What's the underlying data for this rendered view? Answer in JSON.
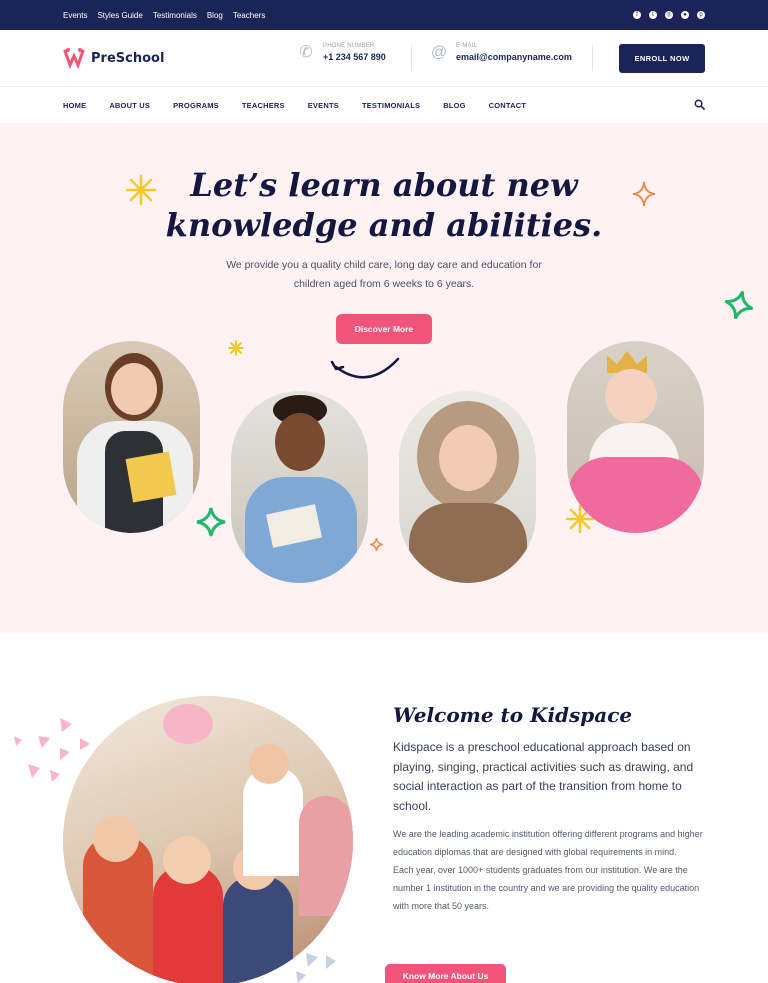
{
  "topbar": {
    "links": [
      "Events",
      "Styles Guide",
      "Testimonials",
      "Blog",
      "Teachers"
    ],
    "social_icons": [
      "facebook-icon",
      "twitter-icon",
      "instagram-icon",
      "dribbble-icon",
      "pinterest-icon"
    ]
  },
  "header": {
    "logo_text": "PreSchool",
    "phone_label": "PHONE NUMBER",
    "phone_value": "+1 234 567 890",
    "email_label": "E-MAIL",
    "email_value": "email@companyname.com",
    "enroll_label": "ENROLL NOW"
  },
  "nav": {
    "items": [
      "HOME",
      "ABOUT US",
      "PROGRAMS",
      "TEACHERS",
      "EVENTS",
      "TESTIMONIALS",
      "BLOG",
      "CONTACT"
    ]
  },
  "hero": {
    "title_line1": "Let’s learn about new",
    "title_line2": "knowledge and abilities.",
    "subtitle_line1": "We provide you a quality child care, long day care and education for",
    "subtitle_line2": "children aged from 6 weeks to 6 years.",
    "cta_label": "Discover More"
  },
  "about": {
    "title": "Welcome to Kidspace",
    "lead": "Kidspace is a preschool educational approach based on playing, singing, practical activities such as drawing, and social interaction as part of the transition from home to school.",
    "para1": "We are the leading academic institution offering different programs and higher education diplomas that are designed with global requirements in mind.",
    "para2": "Each year, over 1000+ students graduates from our institution. We are the number 1 institution in the country and we are providing the quality education with more that 50 years.",
    "cta_label": "Know More About Us"
  },
  "colors": {
    "navy": "#1b2456",
    "pink": "#f05478",
    "hero_bg": "#fff2f5",
    "green_star": "#1fb86a",
    "yellow_star": "#f5c924"
  }
}
